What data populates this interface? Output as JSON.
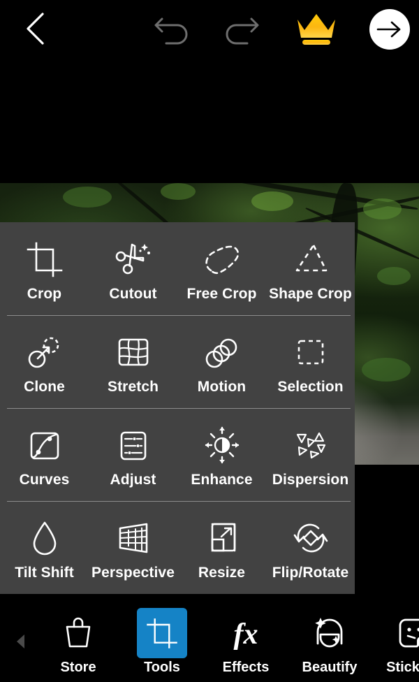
{
  "app": {
    "theme_bg": "#000000",
    "panel_bg": "#424242",
    "accent": "#1583c6",
    "crown_color": "#ffc107"
  },
  "topbar": {
    "back_label": "Back",
    "back_icon": "chevron-left-icon",
    "undo_label": "Undo",
    "undo_icon": "undo-arrow-icon",
    "redo_label": "Redo",
    "redo_icon": "redo-arrow-icon",
    "premium_label": "Premium",
    "premium_icon": "crown-icon",
    "apply_label": "Apply",
    "apply_icon": "arrow-right-icon"
  },
  "canvas": {
    "description": "Forest photo with ferns and stone path"
  },
  "tools_panel": {
    "rows": [
      [
        {
          "label": "Crop",
          "icon": "crop-icon"
        },
        {
          "label": "Cutout",
          "icon": "scissors-sparkle-icon"
        },
        {
          "label": "Free Crop",
          "icon": "lasso-dashed-icon"
        },
        {
          "label": "Shape Crop",
          "icon": "triangle-dashed-icon"
        }
      ],
      [
        {
          "label": "Clone",
          "icon": "clone-stamp-icon"
        },
        {
          "label": "Stretch",
          "icon": "warp-grid-icon"
        },
        {
          "label": "Motion",
          "icon": "motion-circles-icon"
        },
        {
          "label": "Selection",
          "icon": "dashed-square-icon"
        }
      ],
      [
        {
          "label": "Curves",
          "icon": "curves-icon"
        },
        {
          "label": "Adjust",
          "icon": "sliders-panel-icon"
        },
        {
          "label": "Enhance",
          "icon": "brightness-rays-icon"
        },
        {
          "label": "Dispersion",
          "icon": "scattered-triangles-icon"
        }
      ],
      [
        {
          "label": "Tilt Shift",
          "icon": "water-drop-icon"
        },
        {
          "label": "Perspective",
          "icon": "perspective-grid-icon"
        },
        {
          "label": "Resize",
          "icon": "resize-arrow-icon"
        },
        {
          "label": "Flip/Rotate",
          "icon": "rotate-diamond-icon"
        }
      ]
    ]
  },
  "bottom_nav": {
    "scroll_left_icon": "caret-left-icon",
    "active_index": 1,
    "items": [
      {
        "label": "Store",
        "icon": "shopping-bag-icon"
      },
      {
        "label": "Tools",
        "icon": "crop-icon"
      },
      {
        "label": "Effects",
        "icon": "fx-icon"
      },
      {
        "label": "Beautify",
        "icon": "face-sparkle-icon"
      },
      {
        "label": "Stickers",
        "icon": "sticker-face-icon"
      }
    ]
  }
}
